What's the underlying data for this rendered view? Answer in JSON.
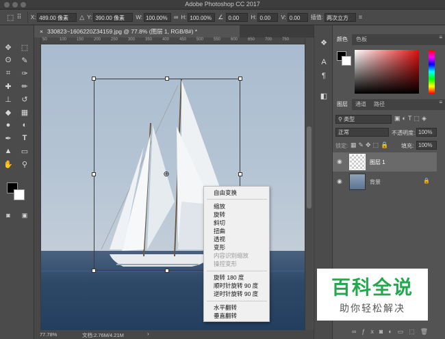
{
  "app_title": "Adobe Photoshop CC 2017",
  "options_bar": {
    "x_label": "X:",
    "x_value": "489.00 像素",
    "y_label": "Y:",
    "y_value": "390.00 像素",
    "w_label": "W:",
    "w_value": "100.00%",
    "h_label": "H:",
    "h_value": "100.00%",
    "angle_value": "0.00",
    "hskew_label": "H:",
    "hskew_value": "0.00",
    "vskew_label": "V:",
    "vskew_value": "0.00",
    "interp_label": "插值:",
    "interp_value": "两次立方"
  },
  "document_tab": "330823~1606220Z34159.jpg @ 77.8% (图层 1, RGB/8#) *",
  "ruler_ticks": [
    "50",
    "100",
    "150",
    "200",
    "250",
    "300",
    "350",
    "400",
    "450",
    "500",
    "550",
    "600",
    "650",
    "700",
    "750"
  ],
  "status": {
    "zoom": "77.78%",
    "doc_size": "文档:2.76M/4.21M"
  },
  "context_menu": {
    "items": [
      {
        "label": "自由变换",
        "enabled": true
      },
      {
        "label": "缩放",
        "enabled": true
      },
      {
        "label": "旋转",
        "enabled": true
      },
      {
        "label": "斜切",
        "enabled": true
      },
      {
        "label": "扭曲",
        "enabled": true
      },
      {
        "label": "透视",
        "enabled": true
      },
      {
        "label": "变形",
        "enabled": true
      },
      {
        "label": "内容识别缩放",
        "enabled": false
      },
      {
        "label": "操控变形",
        "enabled": false
      },
      {
        "label": "旋转 180 度",
        "enabled": true
      },
      {
        "label": "顺时针旋转 90 度",
        "enabled": true
      },
      {
        "label": "逆时针旋转 90 度",
        "enabled": true
      },
      {
        "label": "水平翻转",
        "enabled": true
      },
      {
        "label": "垂直翻转",
        "enabled": true
      }
    ]
  },
  "color_panel": {
    "tab_color": "颜色",
    "tab_swatches": "色板",
    "fg": "#000000",
    "bg": "#ffffff"
  },
  "layers_panel": {
    "tab_layers": "图层",
    "tab_channels": "通道",
    "tab_paths": "路径",
    "filter_label": "类型",
    "blend_mode": "正常",
    "opacity_label": "不透明度:",
    "opacity_value": "100%",
    "lock_label": "锁定:",
    "fill_label": "填充:",
    "fill_value": "100%",
    "layers": [
      {
        "name": "图层 1",
        "selected": true
      },
      {
        "name": "背景",
        "selected": false,
        "locked": true
      }
    ]
  },
  "watermark": {
    "title": "百科全说",
    "subtitle": "助你轻松解决"
  },
  "colors": {
    "panel": "#535353",
    "accent_green": "#23a84d"
  }
}
